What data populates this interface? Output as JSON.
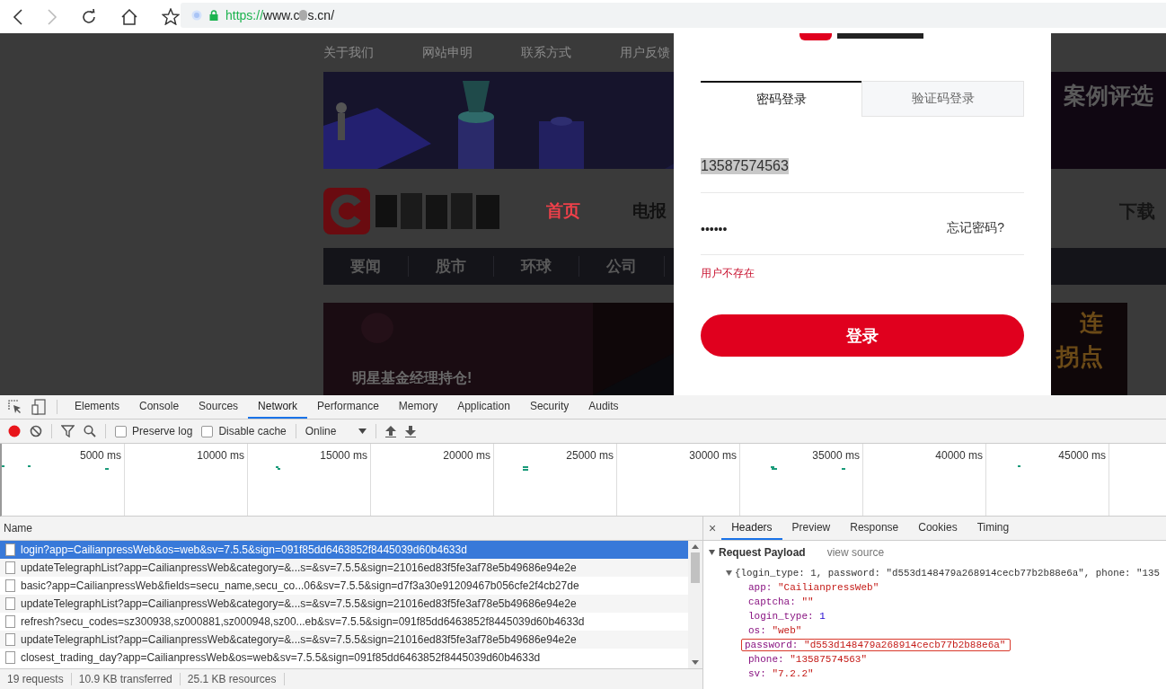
{
  "browser": {
    "url_scheme": "https://",
    "url_host_start": "www.c",
    "url_host_end": "s.cn/"
  },
  "site": {
    "links": [
      "关于我们",
      "网站申明",
      "联系方式",
      "用户反馈"
    ],
    "banner_caption": "案例评选",
    "nav": [
      {
        "label": "首页",
        "selected": true
      },
      {
        "label": "电报",
        "selected": false
      }
    ],
    "download": "下载",
    "menu": [
      "要闻",
      "股市",
      "环球",
      "公司"
    ],
    "promo_caption": "明星基金经理持仓!",
    "promo_side": [
      "连",
      "拐点"
    ]
  },
  "login": {
    "tabs": [
      {
        "label": "密码登录",
        "selected": true
      },
      {
        "label": "验证码登录",
        "selected": false
      }
    ],
    "phone": "13587574563",
    "phone_highlighted": true,
    "password": "••••••",
    "forgot": "忘记密码?",
    "error": "用户不存在",
    "submit": "登录"
  },
  "devtools": {
    "tabs": [
      {
        "label": "Elements",
        "selected": false
      },
      {
        "label": "Console",
        "selected": false
      },
      {
        "label": "Sources",
        "selected": false
      },
      {
        "label": "Network",
        "selected": true
      },
      {
        "label": "Performance",
        "selected": false
      },
      {
        "label": "Memory",
        "selected": false
      },
      {
        "label": "Application",
        "selected": false
      },
      {
        "label": "Security",
        "selected": false
      },
      {
        "label": "Audits",
        "selected": false
      }
    ],
    "preserve_log": {
      "label": "Preserve log",
      "checked": false
    },
    "disable_cache": {
      "label": "Disable cache",
      "checked": false
    },
    "throttle": "Online",
    "timeline_ticks": [
      "5000 ms",
      "10000 ms",
      "15000 ms",
      "20000 ms",
      "25000 ms",
      "30000 ms",
      "35000 ms",
      "40000 ms",
      "45000 ms"
    ],
    "list": {
      "header": "Name",
      "rows": [
        {
          "name": "login?app=CailianpressWeb&os=web&sv=7.5.5&sign=091f85dd6463852f8445039d60b4633d",
          "selected": true
        },
        {
          "name": "updateTelegraphList?app=CailianpressWeb&category=&...s=&sv=7.5.5&sign=21016ed83f5fe3af78e5b49686e94e2e",
          "selected": false
        },
        {
          "name": "basic?app=CailianpressWeb&fields=secu_name,secu_co...06&sv=7.5.5&sign=d7f3a30e91209467b056cfe2f4cb27de",
          "selected": false
        },
        {
          "name": "updateTelegraphList?app=CailianpressWeb&category=&...s=&sv=7.5.5&sign=21016ed83f5fe3af78e5b49686e94e2e",
          "selected": false
        },
        {
          "name": "refresh?secu_codes=sz300938,sz000881,sz000948,sz00...eb&sv=7.5.5&sign=091f85dd6463852f8445039d60b4633d",
          "selected": false
        },
        {
          "name": "updateTelegraphList?app=CailianpressWeb&category=&...s=&sv=7.5.5&sign=21016ed83f5fe3af78e5b49686e94e2e",
          "selected": false
        },
        {
          "name": "closest_trading_day?app=CailianpressWeb&os=web&sv=7.5.5&sign=091f85dd6463852f8445039d60b4633d",
          "selected": false
        }
      ]
    },
    "status": [
      "19 requests",
      "10.9 KB transferred",
      "25.1 KB resources"
    ],
    "detail": {
      "close": "×",
      "tabs": [
        {
          "label": "Headers",
          "selected": true
        },
        {
          "label": "Preview",
          "selected": false
        },
        {
          "label": "Response",
          "selected": false
        },
        {
          "label": "Cookies",
          "selected": false
        },
        {
          "label": "Timing",
          "selected": false
        }
      ],
      "section": "Request Payload",
      "view_source": "view source",
      "summary": "{login_type: 1, password: \"d553d148479a268914cecb77b2b88e6a\", phone: \"135",
      "properties": [
        {
          "key": "app:",
          "value": "\"CailianpressWeb\"",
          "kind": "string",
          "highlighted": false
        },
        {
          "key": "captcha:",
          "value": "\"\"",
          "kind": "string",
          "highlighted": false
        },
        {
          "key": "login_type:",
          "value": "1",
          "kind": "number",
          "highlighted": false
        },
        {
          "key": "os:",
          "value": "\"web\"",
          "kind": "string",
          "highlighted": false
        },
        {
          "key": "password:",
          "value": "\"d553d148479a268914cecb77b2b88e6a\"",
          "kind": "string",
          "highlighted": true
        },
        {
          "key": "phone:",
          "value": "\"13587574563\"",
          "kind": "string",
          "highlighted": false
        },
        {
          "key": "sv:",
          "value": "\"7.2.2\"",
          "kind": "string",
          "highlighted": false
        }
      ]
    }
  }
}
